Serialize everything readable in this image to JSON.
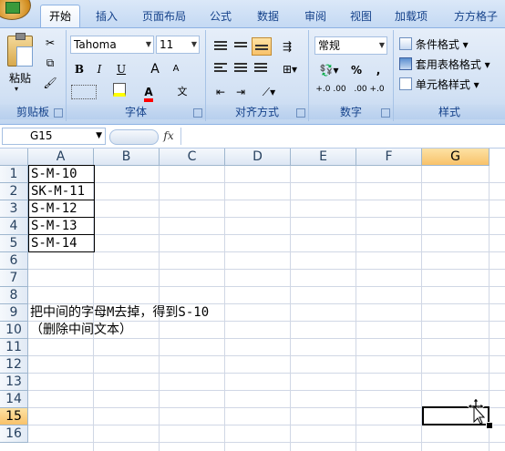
{
  "tabs": [
    "开始",
    "插入",
    "页面布局",
    "公式",
    "数据",
    "审阅",
    "视图",
    "加载项",
    "方方格子"
  ],
  "clipboard": {
    "paste_label": "粘贴",
    "group_label": "剪贴板"
  },
  "font": {
    "name": "Tahoma",
    "size": "11",
    "bold": "B",
    "italic": "I",
    "underline": "U",
    "grow": "A",
    "shrink": "A",
    "font_color_glyph": "A",
    "wen": "文",
    "group_label": "字体"
  },
  "alignment": {
    "group_label": "对齐方式"
  },
  "number": {
    "format": "常规",
    "percent": "%",
    "comma": ",",
    "inc_decimal": "+.0 .00",
    "dec_decimal": ".00 +.0",
    "group_label": "数字"
  },
  "styles": {
    "conditional": "条件格式",
    "table_format": "套用表格格式",
    "cell_styles": "单元格样式",
    "group_label": "样式"
  },
  "formula_bar": {
    "name_box": "G15",
    "fx": "fx",
    "content": ""
  },
  "columns": [
    "A",
    "B",
    "C",
    "D",
    "E",
    "F",
    "G"
  ],
  "rows": [
    "1",
    "2",
    "3",
    "4",
    "5",
    "6",
    "7",
    "8",
    "9",
    "10",
    "11",
    "12",
    "13",
    "14",
    "15",
    "16"
  ],
  "selected_column": "G",
  "selected_row": "15",
  "cells": {
    "A1": "S-M-10",
    "A2": "SK-M-11",
    "A3": "S-M-12",
    "A4": "S-M-13",
    "A5": "S-M-14",
    "A9": "把中间的字母M去掉，得到S-10",
    "A10": "（删除中间文本）"
  }
}
